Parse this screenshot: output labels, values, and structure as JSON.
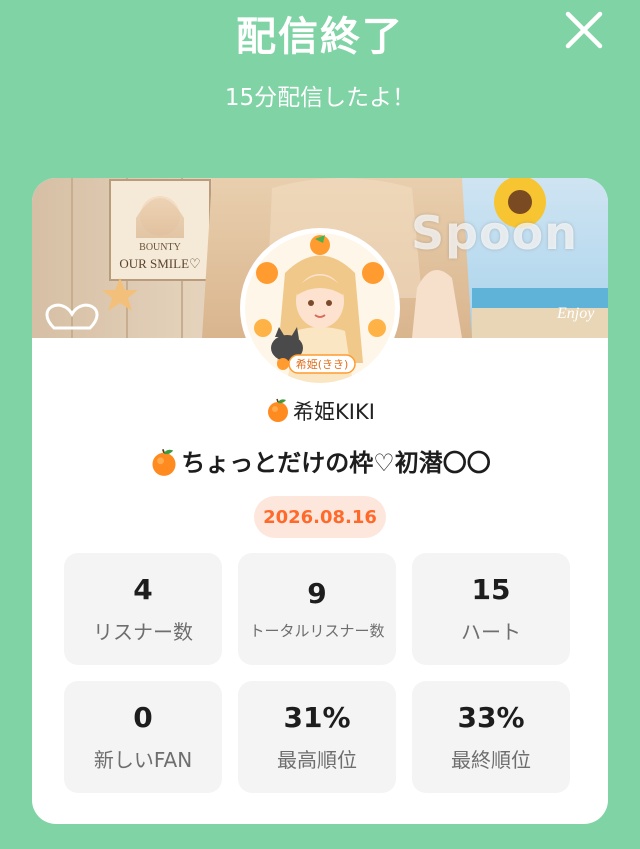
{
  "header": {
    "title": "配信終了",
    "subtitle": "15分配信したよ！"
  },
  "banner": {
    "logo_text": "Spoon",
    "poster_text_1": "BOUNTY",
    "poster_text_2": "OUR SMILE♡",
    "corner_text": "Enjoy"
  },
  "avatar": {
    "name_sticker": "希姫(きき)"
  },
  "dj": {
    "name": "希姫KIKI"
  },
  "cast": {
    "title": "ちょっとだけの枠♡初潜〇〇",
    "date": "2026.08.16"
  },
  "stats": [
    {
      "value": "4",
      "label": "リスナー数"
    },
    {
      "value": "9",
      "label": "トータルリスナー数"
    },
    {
      "value": "15",
      "label": "ハート"
    },
    {
      "value": "0",
      "label": "新しいFAN"
    },
    {
      "value": "31%",
      "label": "最高順位"
    },
    {
      "value": "33%",
      "label": "最終順位"
    }
  ],
  "colors": {
    "background": "#7fd3a5",
    "date_text": "#ff6a2b",
    "date_badge": "#fde7dd",
    "stat_tile": "#f4f4f4"
  },
  "icons": {
    "close": "close-icon",
    "orange": "orange-icon"
  }
}
